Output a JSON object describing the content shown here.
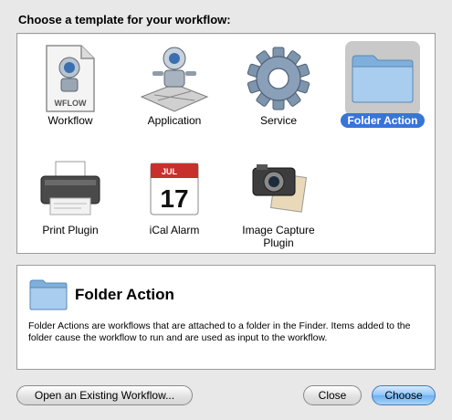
{
  "heading": "Choose a template for your workflow:",
  "templates": [
    {
      "label": "Workflow",
      "icon": "workflow-document-icon",
      "badge": "WFLOW"
    },
    {
      "label": "Application",
      "icon": "automator-robot-icon"
    },
    {
      "label": "Service",
      "icon": "gear-icon"
    },
    {
      "label": "Folder Action",
      "icon": "folder-icon",
      "selected": true
    },
    {
      "label": "Print Plugin",
      "icon": "printer-icon"
    },
    {
      "label": "iCal Alarm",
      "icon": "calendar-icon",
      "month": "JUL",
      "day": "17"
    },
    {
      "label": "Image Capture Plugin",
      "icon": "camera-icon"
    }
  ],
  "info": {
    "title": "Folder Action",
    "description": "Folder Actions are workflows that are attached to a folder in the Finder. Items added to the folder cause the workflow to run and are used as input to the workflow."
  },
  "buttons": {
    "open_existing": "Open an Existing Workflow...",
    "close": "Close",
    "choose": "Choose"
  },
  "colors": {
    "selection": "#3875d7",
    "default_button": "#6db0f0",
    "window_bg": "#e8e8e8"
  }
}
